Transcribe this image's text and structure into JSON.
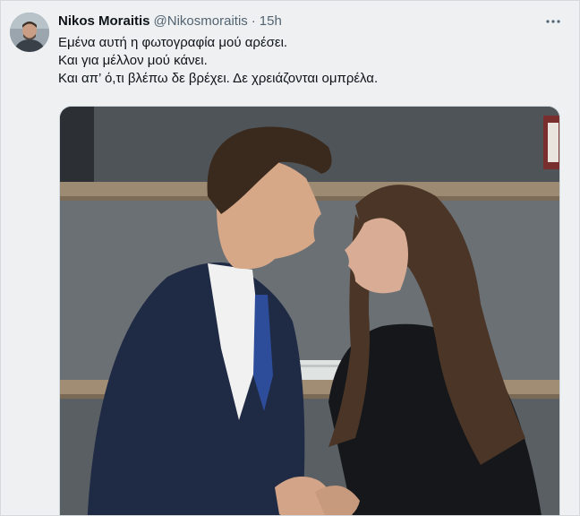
{
  "tweet": {
    "author_name": "Nikos Moraitis",
    "handle": "@Nikosmoraitis",
    "separator": "·",
    "time": "15h",
    "lines": [
      "Εμένα αυτή η φωτογραφία μού αρέσει.",
      "Και για μέλλον μού κάνει.",
      "Και απ’ ό,τι βλέπω δε βρέχει. Δε χρειάζονται ομπρέλα."
    ]
  },
  "icons": {
    "more": "more-horizontal-icon",
    "avatar": "user-avatar"
  },
  "colors": {
    "text": "#0f1419",
    "secondary": "#536471",
    "background": "#eef0f2"
  }
}
